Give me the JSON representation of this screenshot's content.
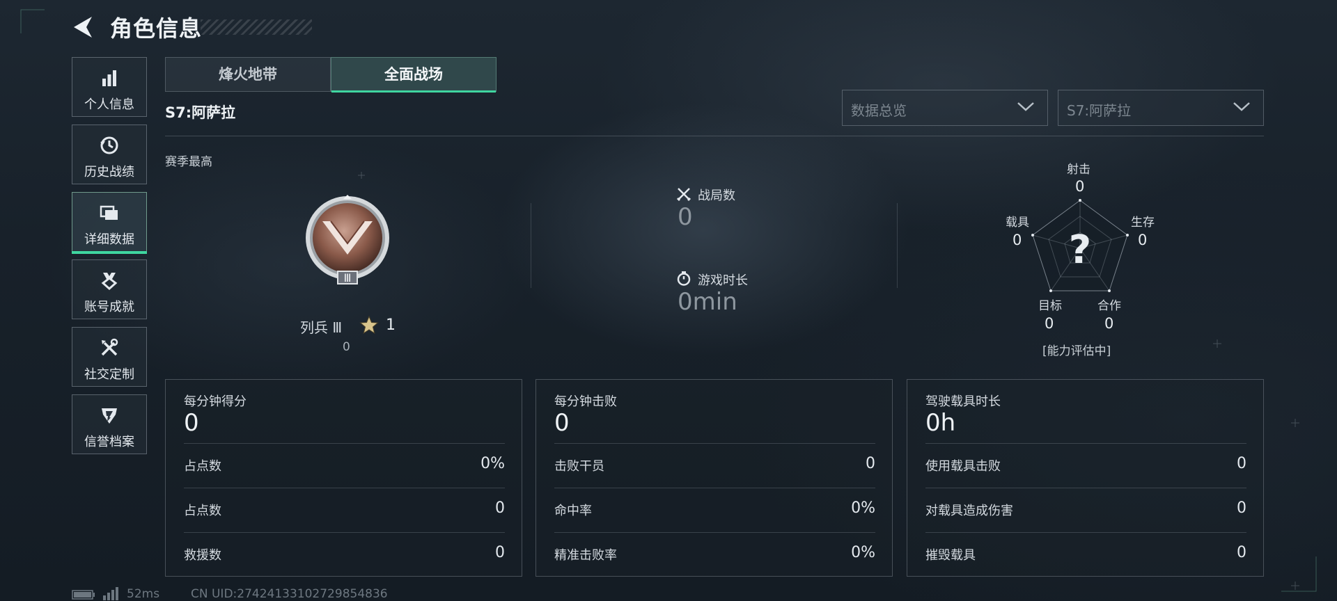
{
  "header": {
    "title": "角色信息"
  },
  "nav": {
    "items": [
      {
        "label": "个人信息",
        "icon": "bar-chart-icon"
      },
      {
        "label": "历史战绩",
        "icon": "history-icon"
      },
      {
        "label": "详细数据",
        "icon": "folder-icon",
        "active": true
      },
      {
        "label": "账号成就",
        "icon": "achievement-icon"
      },
      {
        "label": "社交定制",
        "icon": "tools-icon"
      },
      {
        "label": "信誉档案",
        "icon": "credit-icon"
      }
    ]
  },
  "tabs": [
    {
      "label": "烽火地带",
      "active": false
    },
    {
      "label": "全面战场",
      "active": true
    }
  ],
  "season_label": "S7:阿萨拉",
  "filters": {
    "data_view": "数据总览",
    "season": "S7:阿萨拉"
  },
  "season_best": {
    "label": "赛季最高",
    "rank_name": "列兵 Ⅲ",
    "stars": "1",
    "points": "0",
    "medal_tier": "Ⅲ"
  },
  "mid_stats": {
    "matches_label": "战局数",
    "matches_value": "0",
    "playtime_label": "游戏时长",
    "playtime_value": "0min"
  },
  "radar": {
    "shooting_label": "射击",
    "shooting_value": "0",
    "survival_label": "生存",
    "survival_value": "0",
    "teamwork_label": "合作",
    "teamwork_value": "0",
    "objective_label": "目标",
    "objective_value": "0",
    "vehicle_label": "载具",
    "vehicle_value": "0",
    "center": "?",
    "note": "[能力评估中]"
  },
  "cards": [
    {
      "label": "每分钟得分",
      "value": "0",
      "rows": [
        {
          "label": "占点数",
          "value": "0%"
        },
        {
          "label": "占点数",
          "value": "0"
        },
        {
          "label": "救援数",
          "value": "0"
        }
      ]
    },
    {
      "label": "每分钟击败",
      "value": "0",
      "rows": [
        {
          "label": "击败干员",
          "value": "0"
        },
        {
          "label": "命中率",
          "value": "0%"
        },
        {
          "label": "精准击败率",
          "value": "0%"
        }
      ]
    },
    {
      "label": "驾驶载具时长",
      "value": "0h",
      "rows": [
        {
          "label": "使用载具击败",
          "value": "0"
        },
        {
          "label": "对载具造成伤害",
          "value": "0"
        },
        {
          "label": "摧毁载具",
          "value": "0"
        }
      ]
    }
  ],
  "footer": {
    "ping": "52ms",
    "uid": "CN UID:27424133102729854836"
  },
  "colors": {
    "accent": "#3fd6a0",
    "background": "#18212a",
    "medal": "#8a5a4a"
  }
}
